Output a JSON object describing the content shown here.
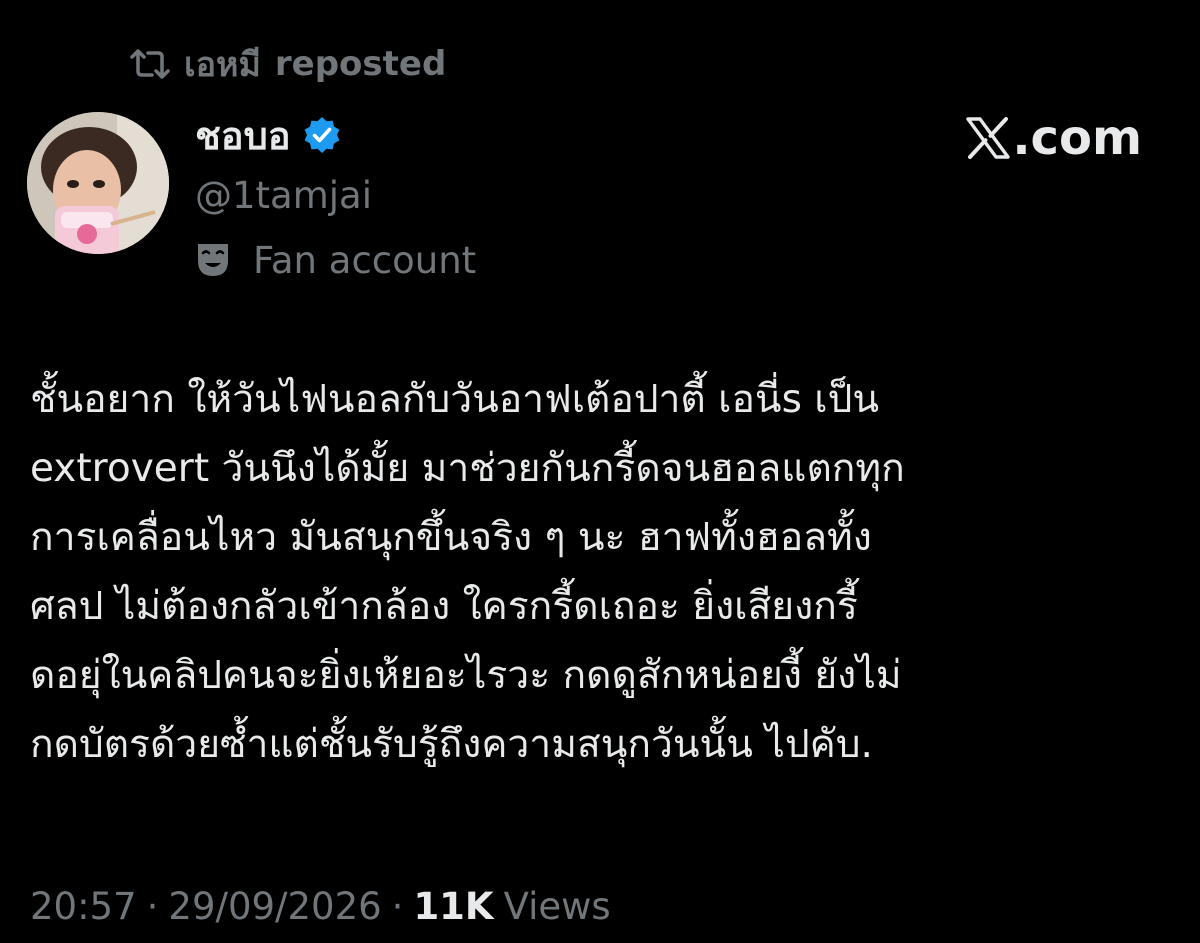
{
  "repost": {
    "user": "เอหมี",
    "action": "reposted"
  },
  "author": {
    "display_name": "ชอบอ",
    "handle": "@1tamjai",
    "label": "Fan account",
    "verified": true
  },
  "brand": {
    "text": ".com"
  },
  "tweet": {
    "lines": [
      "ชั้นอยาก ให้วันไฟนอลกับวันอาฟเต้อปาตี้ เอนี่s เป็น",
      "extrovert วันนึงได้มั้ย มาช่วยกันกรี้ดจนฮอลแตกทุก",
      "การเคลื่อนไหว มันสนุกขึ้นจริง ๆ นะ ฮาฟทั้งฮอลทั้ง",
      "ศลป ไม่ต้องกลัวเข้ากล้อง ใครกรี้ดเถอะ ยิ่งเสียงกรี้",
      "ดอยุ่ในคลิปคนจะยิ่งเห้ยอะไรวะ กดดูสักหน่อยงี้ ยังไม่",
      "กดบัตรด้วยซ้ำแต่ชั้นรับรู้ถึงความสนุกวันนั้น ไปคับ."
    ]
  },
  "meta": {
    "time": "20:57",
    "separator": "·",
    "date": "29/09/2026",
    "views_count": "11K",
    "views_label": "Views"
  },
  "colors": {
    "background": "#000000",
    "primary_text": "#e7e9ea",
    "secondary_text": "#71767b",
    "verified_badge": "#1d9bf0"
  },
  "icons": {
    "repost": "repost-icon",
    "verified": "verified-badge-icon",
    "label": "theater-mask-icon",
    "brand": "x-logo-icon"
  }
}
